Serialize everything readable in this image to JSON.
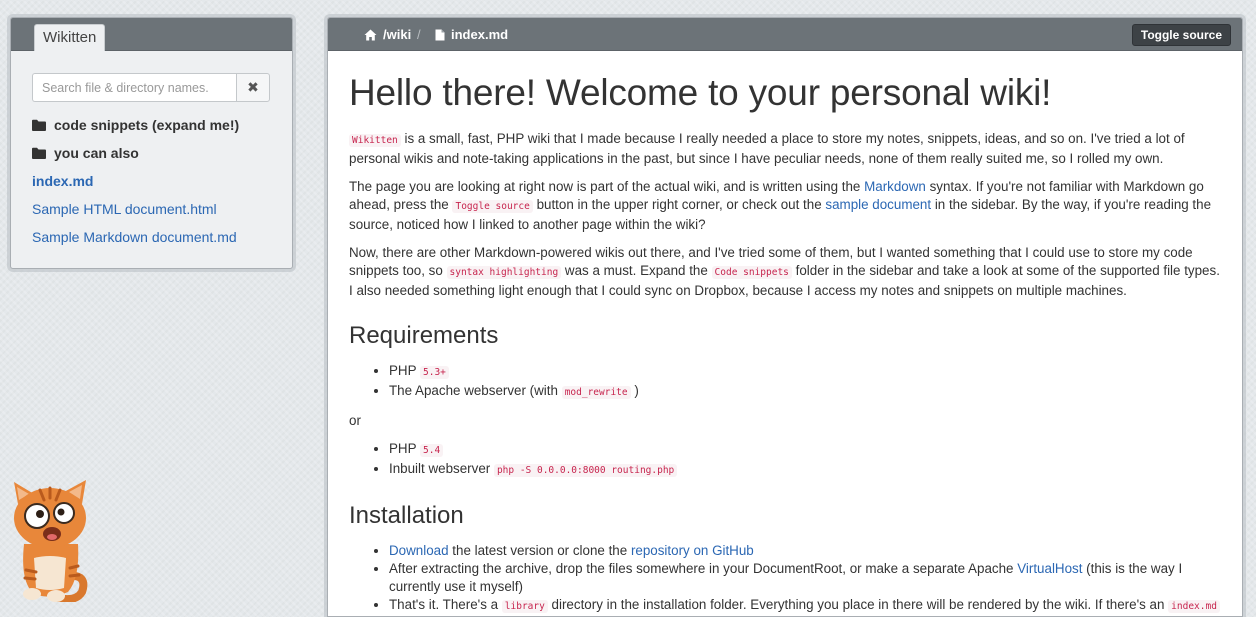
{
  "sidebar": {
    "tab_label": "Wikitten",
    "search_placeholder": "Search file & directory names.",
    "clear_button_glyph": "✖",
    "folders": [
      {
        "label": "code snippets (expand me!)",
        "icon": "folder-icon"
      },
      {
        "label": "you can also",
        "icon": "folder-icon"
      }
    ],
    "files": [
      {
        "label": "index.md",
        "active": true
      },
      {
        "label": "Sample HTML document.html",
        "active": false
      },
      {
        "label": "Sample Markdown document.md",
        "active": false
      }
    ]
  },
  "header": {
    "crumb_root": "/wiki",
    "crumb_separator": "/",
    "crumb_file": "index.md",
    "toggle_source_label": "Toggle source"
  },
  "content": {
    "title": "Hello there! Welcome to your personal wiki!",
    "intro": {
      "code": "Wikitten",
      "text": " is a small, fast, PHP wiki that I made because I really needed a place to store my notes, snippets, ideas, and so on. I've tried a lot of personal wikis and note-taking applications in the past, but since I have peculiar needs, none of them really suited me, so I rolled my own."
    },
    "para2": {
      "t1": "The page you are looking at right now is part of the actual wiki, and is written using the ",
      "link_markdown": "Markdown",
      "t2": " syntax. If you're not familiar with Markdown go ahead, press the ",
      "code_toggle": "Toggle source",
      "t3": " button in the upper right corner, or check out the ",
      "link_sample": "sample document",
      "t4": " in the sidebar. By the way, if you're reading the source, noticed how I linked to another page within the wiki?"
    },
    "para3": {
      "t1": "Now, there are other Markdown-powered wikis out there, and I've tried some of them, but I wanted something that I could use to store my code snippets too, so ",
      "code_syntax": "syntax highlighting",
      "t2": " was a must. Expand the ",
      "code_snippets": "Code snippets",
      "t3": " folder in the sidebar and take a look at some of the supported file types. I also needed something light enough that I could sync on Dropbox, because I access my notes and snippets on multiple machines."
    },
    "requirements": {
      "heading": "Requirements",
      "list1": [
        {
          "text": "PHP ",
          "code": "5.3+",
          "after": ""
        },
        {
          "text": "The Apache webserver (with ",
          "code": "mod_rewrite",
          "after": " )"
        }
      ],
      "or": "or",
      "list2": [
        {
          "text": "PHP ",
          "code": "5.4",
          "after": ""
        },
        {
          "text": "Inbuilt webserver ",
          "code": "php -S 0.0.0.0:8000 routing.php",
          "after": ""
        }
      ]
    },
    "installation": {
      "heading": "Installation",
      "item1": {
        "link1": "Download",
        "t1": " the latest version or clone the ",
        "link2": "repository on GitHub"
      },
      "item2": {
        "t1": "After extracting the archive, drop the files somewhere in your DocumentRoot, or make a separate Apache ",
        "link": "VirtualHost",
        "t2": " (this is the way I currently use it myself)"
      },
      "item3": {
        "t1": "That's it. There's a ",
        "code1": "library",
        "t2": " directory in the installation folder. Everything you place in there will be rendered by the wiki. If there's an ",
        "code2": "index.md"
      }
    }
  },
  "mascot": {
    "icon": "kitten-mascot-icon"
  }
}
